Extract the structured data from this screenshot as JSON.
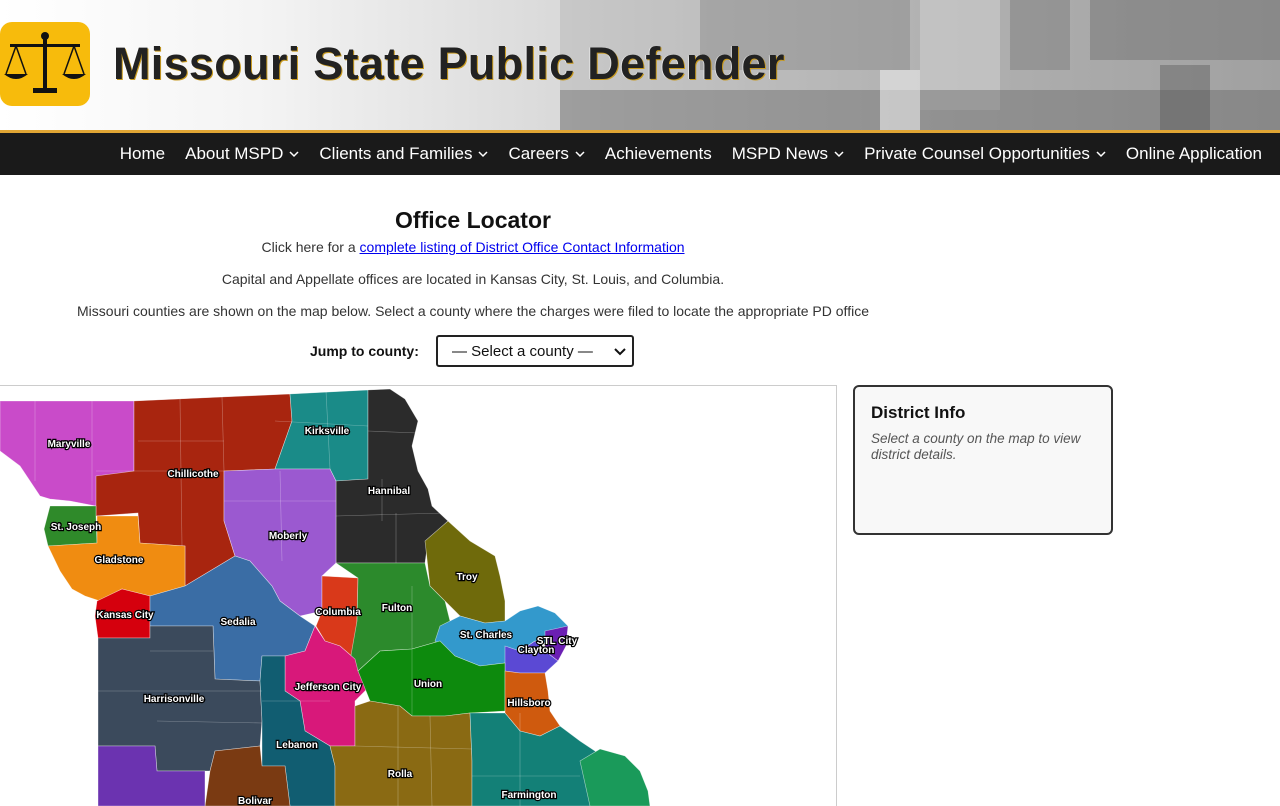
{
  "header": {
    "site_title": "Missouri State Public Defender",
    "logo_icon": "scales-of-justice-icon",
    "logo_color": "#f7bb0c"
  },
  "nav": {
    "items": [
      {
        "label": "Home",
        "has_dropdown": false
      },
      {
        "label": "About MSPD",
        "has_dropdown": true
      },
      {
        "label": "Clients and Families",
        "has_dropdown": true
      },
      {
        "label": "Careers",
        "has_dropdown": true
      },
      {
        "label": "Achievements",
        "has_dropdown": false
      },
      {
        "label": "MSPD News",
        "has_dropdown": true
      },
      {
        "label": "Private Counsel Opportunities",
        "has_dropdown": true
      },
      {
        "label": "Online Application",
        "has_dropdown": false
      }
    ]
  },
  "main": {
    "title": "Office Locator",
    "listing_prefix": "Click here for a ",
    "listing_link": "complete listing of District Office Contact Information",
    "capital_text": "Capital and Appellate offices are located in Kansas City, St. Louis, and Columbia.",
    "instructions": "Missouri counties are shown on the map below. Select a county where the charges were filed to locate the appropriate PD office",
    "jump_label": "Jump to county:",
    "county_select_value": "— Select a county —"
  },
  "map": {
    "offices": [
      "Maryville",
      "Kirksville",
      "Chillicothe",
      "Hannibal",
      "St. Joseph",
      "Moberly",
      "Gladstone",
      "Troy",
      "Fulton",
      "Columbia",
      "Kansas City",
      "Sedalia",
      "St. Charles",
      "STL City",
      "Clayton",
      "Jefferson City",
      "Union",
      "Harrisonville",
      "Hillsboro",
      "Lebanon",
      "Rolla",
      "Farmington",
      "Bolivar"
    ]
  },
  "district_info": {
    "title": "District Info",
    "hint": "Select a county on the map to view district details."
  }
}
